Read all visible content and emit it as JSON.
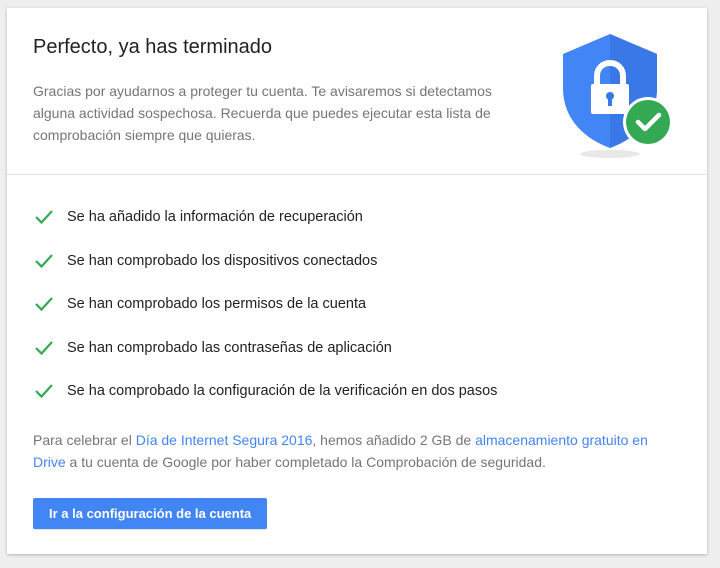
{
  "header": {
    "title": "Perfecto, ya has terminado",
    "subtitle": "Gracias por ayudarnos a proteger tu cuenta. Te avisaremos si detectamos alguna actividad sospechosa. Recuerda que puedes ejecutar esta lista de comprobación siempre que quieras.",
    "illustration": "shield-lock-check-icon"
  },
  "checklist": [
    "Se ha añadido la información de recuperación",
    "Se han comprobado los dispositivos conectados",
    "Se han comprobado los permisos de la cuenta",
    "Se han comprobado las contraseñas de aplicación",
    "Se ha comprobado la configuración de la verificación en dos pasos"
  ],
  "note": {
    "part1": "Para celebrar el ",
    "link1": "Día de Internet Segura 2016",
    "part2": ", hemos añadido 2 GB de ",
    "link2": "almacenamiento gratuito en Drive",
    "part3": " a tu cuenta de Google por haber completado la Comprobación de seguridad."
  },
  "actions": {
    "account_settings_label": "Ir a la configuración de la cuenta"
  },
  "colors": {
    "primary": "#4285f4",
    "check_green": "#34a853",
    "shield_blue": "#4285f4",
    "shield_dark": "#3367d6"
  }
}
